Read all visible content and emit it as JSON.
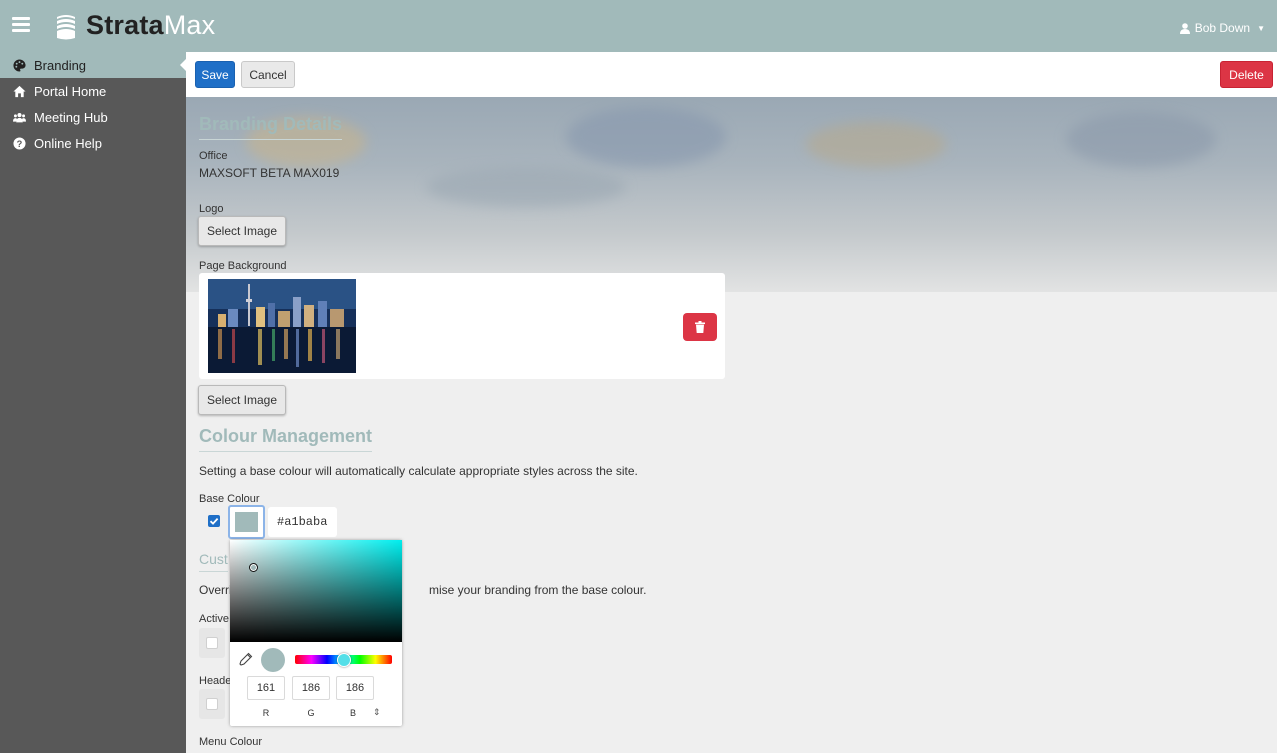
{
  "app": {
    "brand_part1": "Strata",
    "brand_part2": "Max",
    "user": "Bob Down"
  },
  "sidebar": {
    "items": [
      {
        "label": "Branding",
        "icon": "palette-icon",
        "active": true
      },
      {
        "label": "Portal Home",
        "icon": "home-icon",
        "active": false
      },
      {
        "label": "Meeting Hub",
        "icon": "users-icon",
        "active": false
      },
      {
        "label": "Online Help",
        "icon": "question-circle-icon",
        "active": false
      }
    ]
  },
  "toolbar": {
    "save_label": "Save",
    "cancel_label": "Cancel",
    "delete_label": "Delete"
  },
  "branding": {
    "title": "Branding Details",
    "office_label": "Office",
    "office_value": "MAXSOFT BETA MAX019",
    "logo_label": "Logo",
    "logo_button": "Select Image",
    "bg_label": "Page Background",
    "bg_button": "Select Image"
  },
  "colour": {
    "title": "Colour Management",
    "description": "Setting a base colour will automatically calculate appropriate styles across the site.",
    "base_label": "Base Colour",
    "base_enabled": true,
    "base_hex": "#a1baba"
  },
  "custom": {
    "title_partial": "Cust",
    "desc_start": "Overri",
    "desc_end": "mise your branding from the base colour.",
    "active_label_partial": "Active",
    "header_label_partial": "Heade",
    "menu_label": "Menu Colour"
  },
  "picker": {
    "r": "161",
    "g": "186",
    "b": "186",
    "r_label": "R",
    "g_label": "G",
    "b_label": "B",
    "hue_fraction": 0.5
  },
  "colors": {
    "accent": "#a1baba",
    "primary": "#1f6fc7",
    "danger": "#dc3545",
    "sidebar": "#585858"
  }
}
